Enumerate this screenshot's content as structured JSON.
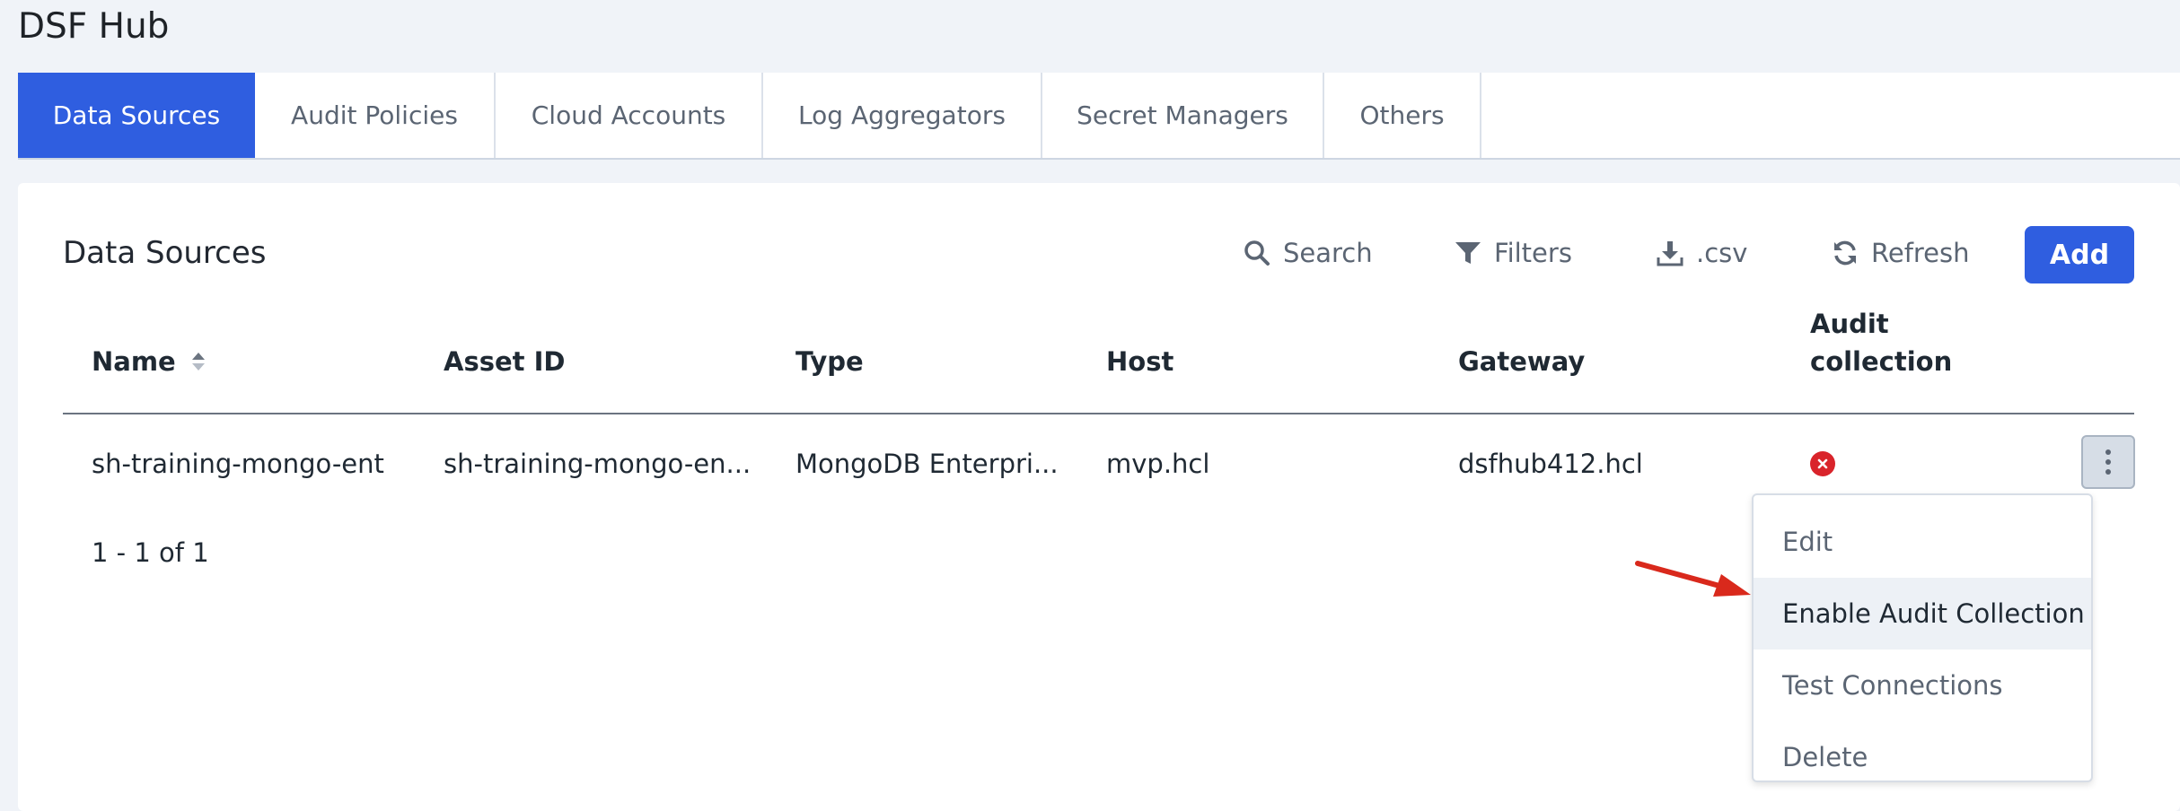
{
  "app": {
    "title": "DSF Hub"
  },
  "tabs": [
    {
      "label": "Data Sources",
      "active": true
    },
    {
      "label": "Audit Policies",
      "active": false
    },
    {
      "label": "Cloud Accounts",
      "active": false
    },
    {
      "label": "Log Aggregators",
      "active": false
    },
    {
      "label": "Secret Managers",
      "active": false
    },
    {
      "label": "Others",
      "active": false
    }
  ],
  "panel": {
    "title": "Data Sources",
    "toolbar": {
      "search_label": "Search",
      "search_icon": "search-icon",
      "filters_label": "Filters",
      "filters_icon": "filter-icon",
      "csv_label": ".csv",
      "csv_icon": "download-icon",
      "refresh_label": "Refresh",
      "refresh_icon": "refresh-icon",
      "add_label": "Add"
    }
  },
  "table": {
    "columns": [
      "Name",
      "Asset ID",
      "Type",
      "Host",
      "Gateway",
      "Audit",
      "collection"
    ],
    "rows": [
      {
        "name": "sh-training-mongo-ent",
        "asset_id": "sh-training-mongo-en...",
        "type": "MongoDB Enterpri...",
        "host": "mvp.hcl",
        "gateway": "dsfhub412.hcl",
        "audit_collection": "disabled",
        "status_icon": "error-x-icon"
      }
    ]
  },
  "pagination": {
    "text": "1 - 1 of 1"
  },
  "context_menu": {
    "items": [
      "Edit",
      "Enable Audit Collection",
      "Test Connections",
      "Delete"
    ],
    "highlighted_index": 1
  },
  "colors": {
    "accent": "#2f5ee0",
    "error": "#d9242b",
    "annotation_arrow": "#d9291c"
  }
}
